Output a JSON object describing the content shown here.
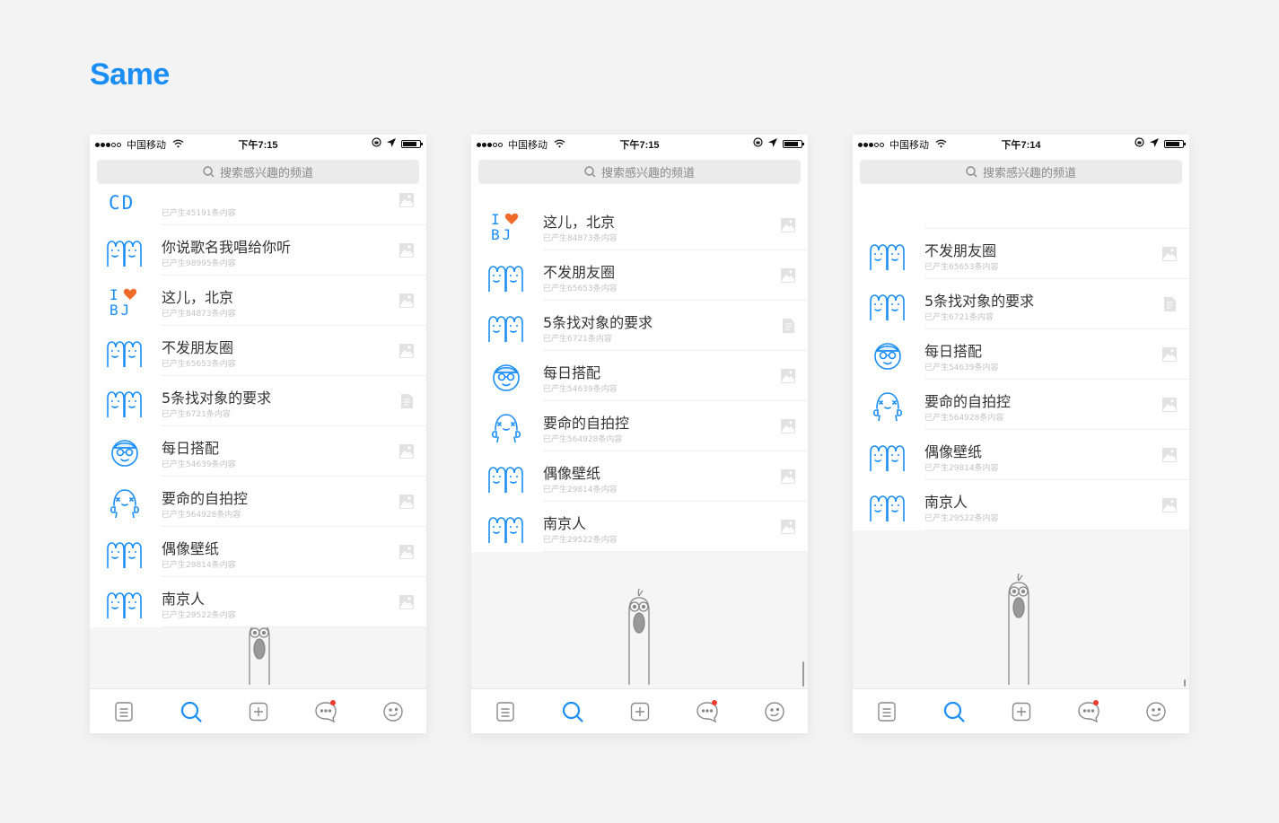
{
  "page_title": "Same",
  "colors": {
    "accent": "#1a8ef5",
    "heart": "#f06a2a",
    "badge": "#ef3a2e"
  },
  "screens": [
    {
      "status": {
        "carrier": "中国移动",
        "time": "下午7:15"
      },
      "search_placeholder": "搜索感兴趣的频道",
      "channels": [
        {
          "name": "",
          "count": "已产生45191条内容",
          "avatar": "cd-icon",
          "thumb": "image-icon"
        },
        {
          "name": "你说歌名我唱给你听",
          "count": "已产生98995条内容",
          "avatar": "twin-faces-icon",
          "thumb": "image-icon"
        },
        {
          "name": "这儿，北京",
          "count": "已产生84873条内容",
          "avatar": "i-love-bj-icon",
          "thumb": "image-icon"
        },
        {
          "name": "不发朋友圈",
          "count": "已产生65653条内容",
          "avatar": "twin-faces-icon",
          "thumb": "image-icon"
        },
        {
          "name": "5条找对象的要求",
          "count": "已产生6721条内容",
          "avatar": "twin-faces-icon",
          "thumb": "document-icon"
        },
        {
          "name": "每日搭配",
          "count": "已产生54639条内容",
          "avatar": "glasses-face-icon",
          "thumb": "image-icon"
        },
        {
          "name": "要命的自拍控",
          "count": "已产生564928条内容",
          "avatar": "selfie-face-icon",
          "thumb": "image-icon"
        },
        {
          "name": "偶像壁纸",
          "count": "已产生29814条内容",
          "avatar": "twin-faces-icon",
          "thumb": "image-icon"
        },
        {
          "name": "南京人",
          "count": "已产生29522条内容",
          "avatar": "twin-faces-icon",
          "thumb": "image-icon"
        }
      ]
    },
    {
      "status": {
        "carrier": "中国移动",
        "time": "下午7:15"
      },
      "search_placeholder": "搜索感兴趣的频道",
      "channels": [
        {
          "name": "这儿，北京",
          "count": "已产生84873条内容",
          "avatar": "i-love-bj-icon",
          "thumb": "image-icon"
        },
        {
          "name": "不发朋友圈",
          "count": "已产生65653条内容",
          "avatar": "twin-faces-icon",
          "thumb": "image-icon"
        },
        {
          "name": "5条找对象的要求",
          "count": "已产生6721条内容",
          "avatar": "twin-faces-icon",
          "thumb": "document-icon"
        },
        {
          "name": "每日搭配",
          "count": "已产生54639条内容",
          "avatar": "glasses-face-icon",
          "thumb": "image-icon"
        },
        {
          "name": "要命的自拍控",
          "count": "已产生564928条内容",
          "avatar": "selfie-face-icon",
          "thumb": "image-icon"
        },
        {
          "name": "偶像壁纸",
          "count": "已产生29814条内容",
          "avatar": "twin-faces-icon",
          "thumb": "image-icon"
        },
        {
          "name": "南京人",
          "count": "已产生29522条内容",
          "avatar": "twin-faces-icon",
          "thumb": "image-icon"
        }
      ]
    },
    {
      "status": {
        "carrier": "中国移动",
        "time": "下午7:14"
      },
      "search_placeholder": "搜索感兴趣的频道",
      "channels": [
        {
          "name": "不发朋友圈",
          "count": "已产生65653条内容",
          "avatar": "twin-faces-icon",
          "thumb": "image-icon"
        },
        {
          "name": "5条找对象的要求",
          "count": "已产生6721条内容",
          "avatar": "twin-faces-icon",
          "thumb": "document-icon"
        },
        {
          "name": "每日搭配",
          "count": "已产生54639条内容",
          "avatar": "glasses-face-icon",
          "thumb": "image-icon"
        },
        {
          "name": "要命的自拍控",
          "count": "已产生564928条内容",
          "avatar": "selfie-face-icon",
          "thumb": "image-icon"
        },
        {
          "name": "偶像壁纸",
          "count": "已产生29814条内容",
          "avatar": "twin-faces-icon",
          "thumb": "image-icon"
        },
        {
          "name": "南京人",
          "count": "已产生29522条内容",
          "avatar": "twin-faces-icon",
          "thumb": "image-icon"
        }
      ]
    }
  ],
  "tab_bar": [
    {
      "icon": "list-icon",
      "active": false,
      "badge": false
    },
    {
      "icon": "search-icon",
      "active": true,
      "badge": false
    },
    {
      "icon": "add-icon",
      "active": false,
      "badge": false
    },
    {
      "icon": "message-icon",
      "active": false,
      "badge": true
    },
    {
      "icon": "face-icon",
      "active": false,
      "badge": false
    }
  ]
}
